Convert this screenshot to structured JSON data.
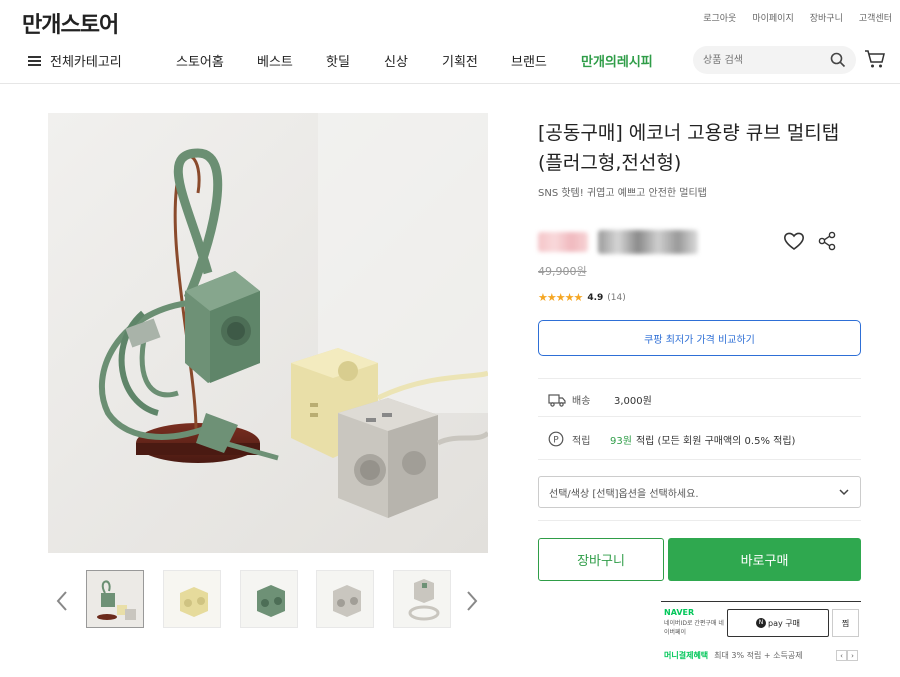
{
  "header": {
    "logo": "만개스토어",
    "util_links": [
      "로그아웃",
      "마이페이지",
      "장바구니",
      "고객센터"
    ],
    "all_categories": "전체카테고리",
    "nav": [
      "스토어홈",
      "베스트",
      "핫딜",
      "신상",
      "기획전",
      "브랜드"
    ],
    "brand_nav": "만개의레시피",
    "search_placeholder": "상품 검색"
  },
  "product": {
    "title": "[공동구매] 에코너 고용량 큐브 멀티탭(플러그형,전선형)",
    "subtitle": "SNS 핫템! 귀엽고 예쁘고 안전한 멀티탭",
    "original_price": "49,900원",
    "rating": "4.9",
    "review_count": "(14)",
    "compare_label": "쿠팡 최저가 가격 비교하기",
    "shipping_label": "배송",
    "shipping_value": "3,000원",
    "points_label": "적립",
    "points_value": "93원",
    "points_desc": "적립 (모든 회원 구매액의 0.5% 적립)",
    "option_placeholder": "선택/색상 [선택]옵션을 선택하세요.",
    "cart_label": "장바구니",
    "buy_label": "바로구매"
  },
  "npay": {
    "naver": "NAVER",
    "desc": "네이버ID로 간편구매 네이버페이",
    "pay_label": "pay 구매",
    "zzim": "찜",
    "benefit_title": "머니결제혜택",
    "benefit_text": "최대 3% 적립 + 소득공제"
  },
  "colors": {
    "accent_green": "#2fa84f",
    "link_blue": "#2e6fd6",
    "naver_green": "#03c75a"
  }
}
